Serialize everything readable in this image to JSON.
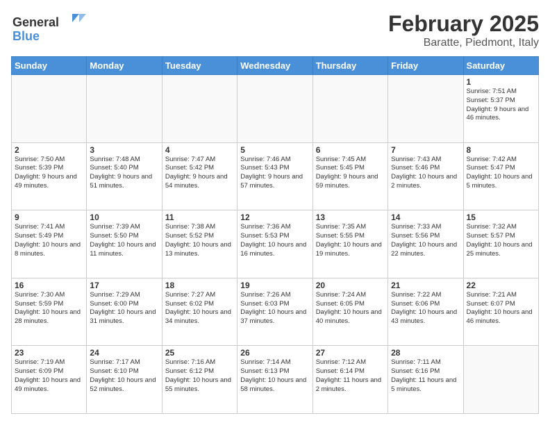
{
  "logo": {
    "line1": "General",
    "line2": "Blue"
  },
  "title": "February 2025",
  "subtitle": "Baratte, Piedmont, Italy",
  "days_of_week": [
    "Sunday",
    "Monday",
    "Tuesday",
    "Wednesday",
    "Thursday",
    "Friday",
    "Saturday"
  ],
  "weeks": [
    [
      {
        "day": "",
        "info": ""
      },
      {
        "day": "",
        "info": ""
      },
      {
        "day": "",
        "info": ""
      },
      {
        "day": "",
        "info": ""
      },
      {
        "day": "",
        "info": ""
      },
      {
        "day": "",
        "info": ""
      },
      {
        "day": "1",
        "info": "Sunrise: 7:51 AM\nSunset: 5:37 PM\nDaylight: 9 hours and 46 minutes."
      }
    ],
    [
      {
        "day": "2",
        "info": "Sunrise: 7:50 AM\nSunset: 5:39 PM\nDaylight: 9 hours and 49 minutes."
      },
      {
        "day": "3",
        "info": "Sunrise: 7:48 AM\nSunset: 5:40 PM\nDaylight: 9 hours and 51 minutes."
      },
      {
        "day": "4",
        "info": "Sunrise: 7:47 AM\nSunset: 5:42 PM\nDaylight: 9 hours and 54 minutes."
      },
      {
        "day": "5",
        "info": "Sunrise: 7:46 AM\nSunset: 5:43 PM\nDaylight: 9 hours and 57 minutes."
      },
      {
        "day": "6",
        "info": "Sunrise: 7:45 AM\nSunset: 5:45 PM\nDaylight: 9 hours and 59 minutes."
      },
      {
        "day": "7",
        "info": "Sunrise: 7:43 AM\nSunset: 5:46 PM\nDaylight: 10 hours and 2 minutes."
      },
      {
        "day": "8",
        "info": "Sunrise: 7:42 AM\nSunset: 5:47 PM\nDaylight: 10 hours and 5 minutes."
      }
    ],
    [
      {
        "day": "9",
        "info": "Sunrise: 7:41 AM\nSunset: 5:49 PM\nDaylight: 10 hours and 8 minutes."
      },
      {
        "day": "10",
        "info": "Sunrise: 7:39 AM\nSunset: 5:50 PM\nDaylight: 10 hours and 11 minutes."
      },
      {
        "day": "11",
        "info": "Sunrise: 7:38 AM\nSunset: 5:52 PM\nDaylight: 10 hours and 13 minutes."
      },
      {
        "day": "12",
        "info": "Sunrise: 7:36 AM\nSunset: 5:53 PM\nDaylight: 10 hours and 16 minutes."
      },
      {
        "day": "13",
        "info": "Sunrise: 7:35 AM\nSunset: 5:55 PM\nDaylight: 10 hours and 19 minutes."
      },
      {
        "day": "14",
        "info": "Sunrise: 7:33 AM\nSunset: 5:56 PM\nDaylight: 10 hours and 22 minutes."
      },
      {
        "day": "15",
        "info": "Sunrise: 7:32 AM\nSunset: 5:57 PM\nDaylight: 10 hours and 25 minutes."
      }
    ],
    [
      {
        "day": "16",
        "info": "Sunrise: 7:30 AM\nSunset: 5:59 PM\nDaylight: 10 hours and 28 minutes."
      },
      {
        "day": "17",
        "info": "Sunrise: 7:29 AM\nSunset: 6:00 PM\nDaylight: 10 hours and 31 minutes."
      },
      {
        "day": "18",
        "info": "Sunrise: 7:27 AM\nSunset: 6:02 PM\nDaylight: 10 hours and 34 minutes."
      },
      {
        "day": "19",
        "info": "Sunrise: 7:26 AM\nSunset: 6:03 PM\nDaylight: 10 hours and 37 minutes."
      },
      {
        "day": "20",
        "info": "Sunrise: 7:24 AM\nSunset: 6:05 PM\nDaylight: 10 hours and 40 minutes."
      },
      {
        "day": "21",
        "info": "Sunrise: 7:22 AM\nSunset: 6:06 PM\nDaylight: 10 hours and 43 minutes."
      },
      {
        "day": "22",
        "info": "Sunrise: 7:21 AM\nSunset: 6:07 PM\nDaylight: 10 hours and 46 minutes."
      }
    ],
    [
      {
        "day": "23",
        "info": "Sunrise: 7:19 AM\nSunset: 6:09 PM\nDaylight: 10 hours and 49 minutes."
      },
      {
        "day": "24",
        "info": "Sunrise: 7:17 AM\nSunset: 6:10 PM\nDaylight: 10 hours and 52 minutes."
      },
      {
        "day": "25",
        "info": "Sunrise: 7:16 AM\nSunset: 6:12 PM\nDaylight: 10 hours and 55 minutes."
      },
      {
        "day": "26",
        "info": "Sunrise: 7:14 AM\nSunset: 6:13 PM\nDaylight: 10 hours and 58 minutes."
      },
      {
        "day": "27",
        "info": "Sunrise: 7:12 AM\nSunset: 6:14 PM\nDaylight: 11 hours and 2 minutes."
      },
      {
        "day": "28",
        "info": "Sunrise: 7:11 AM\nSunset: 6:16 PM\nDaylight: 11 hours and 5 minutes."
      },
      {
        "day": "",
        "info": ""
      }
    ]
  ]
}
